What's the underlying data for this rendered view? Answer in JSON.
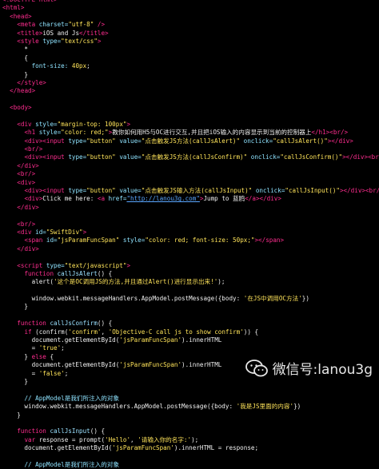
{
  "code": [
    [
      [
        "tag",
        "<!DOCTYPE html>"
      ]
    ],
    [
      [
        "tag",
        "<html>"
      ]
    ],
    [
      [
        "txt",
        "  "
      ],
      [
        "tag",
        "<head>"
      ]
    ],
    [
      [
        "txt",
        "    "
      ],
      [
        "tag",
        "<meta "
      ],
      [
        "attr",
        "charset="
      ],
      [
        "str",
        "\"utf-8\""
      ],
      [
        "tag",
        " />"
      ]
    ],
    [
      [
        "txt",
        "    "
      ],
      [
        "tag",
        "<title>"
      ],
      [
        "txt",
        "iOS and Js"
      ],
      [
        "tag",
        "</title>"
      ]
    ],
    [
      [
        "txt",
        "    "
      ],
      [
        "tag",
        "<style "
      ],
      [
        "attr",
        "type="
      ],
      [
        "str",
        "\"text/css\""
      ],
      [
        "tag",
        ">"
      ]
    ],
    [
      [
        "txt",
        "      *"
      ]
    ],
    [
      [
        "txt",
        "      {"
      ]
    ],
    [
      [
        "txt",
        "        "
      ],
      [
        "attr",
        "font-size: "
      ],
      [
        "str",
        "40px"
      ],
      [
        "txt",
        ";"
      ]
    ],
    [
      [
        "txt",
        "      }"
      ]
    ],
    [
      [
        "txt",
        "    "
      ],
      [
        "tag",
        "</style>"
      ]
    ],
    [
      [
        "txt",
        "  "
      ],
      [
        "tag",
        "</head>"
      ]
    ],
    [
      [
        "txt",
        ""
      ]
    ],
    [
      [
        "txt",
        "  "
      ],
      [
        "tag",
        "<body>"
      ]
    ],
    [
      [
        "txt",
        ""
      ]
    ],
    [
      [
        "txt",
        "    "
      ],
      [
        "tag",
        "<div "
      ],
      [
        "attr",
        "style="
      ],
      [
        "str",
        "\"margin-top: 100px\""
      ],
      [
        "tag",
        ">"
      ]
    ],
    [
      [
        "txt",
        "      "
      ],
      [
        "tag",
        "<h1 "
      ],
      [
        "attr",
        "style="
      ],
      [
        "str",
        "\"color: red;\""
      ],
      [
        "tag",
        ">"
      ],
      [
        "txt",
        "教你如何用H5与OC进行交互,并且把iOS输入的内容显示到当前的控制器上"
      ],
      [
        "tag",
        "</h1><br/>"
      ]
    ],
    [
      [
        "txt",
        "      "
      ],
      [
        "tag",
        "<div><input "
      ],
      [
        "attr",
        "type="
      ],
      [
        "str",
        "\"button\" "
      ],
      [
        "attr",
        "value="
      ],
      [
        "str",
        "\"点击触发JS方法(callJsAlert)\" "
      ],
      [
        "attr",
        "onclick="
      ],
      [
        "str",
        "\"callJsAlert()\""
      ],
      [
        "tag",
        "></div>"
      ]
    ],
    [
      [
        "txt",
        "      "
      ],
      [
        "tag",
        "<br/>"
      ]
    ],
    [
      [
        "txt",
        "      "
      ],
      [
        "tag",
        "<div><input "
      ],
      [
        "attr",
        "type="
      ],
      [
        "str",
        "\"button\" "
      ],
      [
        "attr",
        "value="
      ],
      [
        "str",
        "\"点击触发JS方法(callJsConfirm)\" "
      ],
      [
        "attr",
        "onclick="
      ],
      [
        "str",
        "\"callJsConfirm()\""
      ],
      [
        "tag",
        "></div><br/>"
      ]
    ],
    [
      [
        "txt",
        "    "
      ],
      [
        "tag",
        "</div>"
      ]
    ],
    [
      [
        "txt",
        "    "
      ],
      [
        "tag",
        "<br/>"
      ]
    ],
    [
      [
        "txt",
        "    "
      ],
      [
        "tag",
        "<div>"
      ]
    ],
    [
      [
        "txt",
        "      "
      ],
      [
        "tag",
        "<div><input "
      ],
      [
        "attr",
        "type="
      ],
      [
        "str",
        "\"button\" "
      ],
      [
        "attr",
        "value="
      ],
      [
        "str",
        "\"点击触发JS输入方法(callJsInput)\" "
      ],
      [
        "attr",
        "onclick="
      ],
      [
        "str",
        "\"callJsInput()\""
      ],
      [
        "tag",
        "></div><br/>"
      ]
    ],
    [
      [
        "txt",
        "      "
      ],
      [
        "tag",
        "<div>"
      ],
      [
        "txt",
        "Click me here: "
      ],
      [
        "tag",
        "<a "
      ],
      [
        "attr",
        "href="
      ],
      [
        "lnk",
        "\"http://lanou3g.com\""
      ],
      [
        "tag",
        ">"
      ],
      [
        "txt",
        "Jump to 蓝鸥"
      ],
      [
        "tag",
        "</a></div>"
      ]
    ],
    [
      [
        "txt",
        "    "
      ],
      [
        "tag",
        "</div>"
      ]
    ],
    [
      [
        "txt",
        ""
      ]
    ],
    [
      [
        "txt",
        "    "
      ],
      [
        "tag",
        "<br/>"
      ]
    ],
    [
      [
        "txt",
        "    "
      ],
      [
        "tag",
        "<div "
      ],
      [
        "attr",
        "id="
      ],
      [
        "str",
        "\"SwiftDiv\""
      ],
      [
        "tag",
        ">"
      ]
    ],
    [
      [
        "txt",
        "      "
      ],
      [
        "tag",
        "<span "
      ],
      [
        "attr",
        "id="
      ],
      [
        "str",
        "\"jsParamFuncSpan\" "
      ],
      [
        "attr",
        "style="
      ],
      [
        "str",
        "\"color: red; font-size: 50px;\""
      ],
      [
        "tag",
        "></span>"
      ]
    ],
    [
      [
        "txt",
        "    "
      ],
      [
        "tag",
        "</div>"
      ]
    ],
    [
      [
        "txt",
        ""
      ]
    ],
    [
      [
        "txt",
        "    "
      ],
      [
        "tag",
        "<script "
      ],
      [
        "attr",
        "type="
      ],
      [
        "str",
        "\"text/javascript\""
      ],
      [
        "tag",
        ">"
      ]
    ],
    [
      [
        "txt",
        "      "
      ],
      [
        "kw",
        "function "
      ],
      [
        "fn",
        "callJsAlert"
      ],
      [
        "txt",
        "() {"
      ]
    ],
    [
      [
        "txt",
        "        alert("
      ],
      [
        "str",
        "'这个是OC调用JS的方法,并且通过Alert()进行显示出来!'"
      ],
      [
        "txt",
        ");"
      ]
    ],
    [
      [
        "txt",
        ""
      ]
    ],
    [
      [
        "txt",
        "        window.webkit.messageHandlers.AppModel.postMessage({body: "
      ],
      [
        "str",
        "'在JS中调用OC方法'"
      ],
      [
        "txt",
        "})"
      ]
    ],
    [
      [
        "txt",
        "      }"
      ]
    ],
    [
      [
        "txt",
        ""
      ]
    ],
    [
      [
        "txt",
        "    "
      ],
      [
        "kw",
        "function "
      ],
      [
        "fn",
        "callJsConfirm"
      ],
      [
        "txt",
        "() {"
      ]
    ],
    [
      [
        "txt",
        "      "
      ],
      [
        "kw",
        "if "
      ],
      [
        "txt",
        "(confirm("
      ],
      [
        "str",
        "'confirm'"
      ],
      [
        "txt",
        ", "
      ],
      [
        "str",
        "'Objective-C call js to show confirm'"
      ],
      [
        "txt",
        ")) {"
      ]
    ],
    [
      [
        "txt",
        "        document.getElementById("
      ],
      [
        "str",
        "'jsParamFuncSpan'"
      ],
      [
        "txt",
        ").innerHTML"
      ]
    ],
    [
      [
        "txt",
        "        = "
      ],
      [
        "str",
        "'true'"
      ],
      [
        "txt",
        ";"
      ]
    ],
    [
      [
        "txt",
        "      } "
      ],
      [
        "kw",
        "else "
      ],
      [
        "txt",
        "{"
      ]
    ],
    [
      [
        "txt",
        "        document.getElementById("
      ],
      [
        "str",
        "'jsParamFuncSpan'"
      ],
      [
        "txt",
        ").innerHTML"
      ]
    ],
    [
      [
        "txt",
        "        = "
      ],
      [
        "str",
        "'false'"
      ],
      [
        "txt",
        ";"
      ]
    ],
    [
      [
        "txt",
        "      }"
      ]
    ],
    [
      [
        "txt",
        ""
      ]
    ],
    [
      [
        "txt",
        "      "
      ],
      [
        "cmt",
        "// AppModel是我们所注入的对象"
      ]
    ],
    [
      [
        "txt",
        "      window.webkit.messageHandlers.AppModel.postMessage({body: "
      ],
      [
        "str",
        "'我是JS里面的内容'"
      ],
      [
        "txt",
        "})"
      ]
    ],
    [
      [
        "txt",
        "    }"
      ]
    ],
    [
      [
        "txt",
        ""
      ]
    ],
    [
      [
        "txt",
        "    "
      ],
      [
        "kw",
        "function "
      ],
      [
        "fn",
        "callJsInput"
      ],
      [
        "txt",
        "() {"
      ]
    ],
    [
      [
        "txt",
        "      "
      ],
      [
        "kw",
        "var "
      ],
      [
        "txt",
        "response = prompt("
      ],
      [
        "str",
        "'Hello'"
      ],
      [
        "txt",
        ", "
      ],
      [
        "str",
        "'请输入你的名字:'"
      ],
      [
        "txt",
        ");"
      ]
    ],
    [
      [
        "txt",
        "      document.getElementById("
      ],
      [
        "str",
        "'jsParamFuncSpan'"
      ],
      [
        "txt",
        ").innerHTML = response;"
      ]
    ],
    [
      [
        "txt",
        ""
      ]
    ],
    [
      [
        "txt",
        "      "
      ],
      [
        "cmt",
        "// AppModel是我们所注入的对象"
      ]
    ]
  ],
  "watermark": {
    "icon": "wechat-icon",
    "label": "微信号:lanou3g"
  }
}
